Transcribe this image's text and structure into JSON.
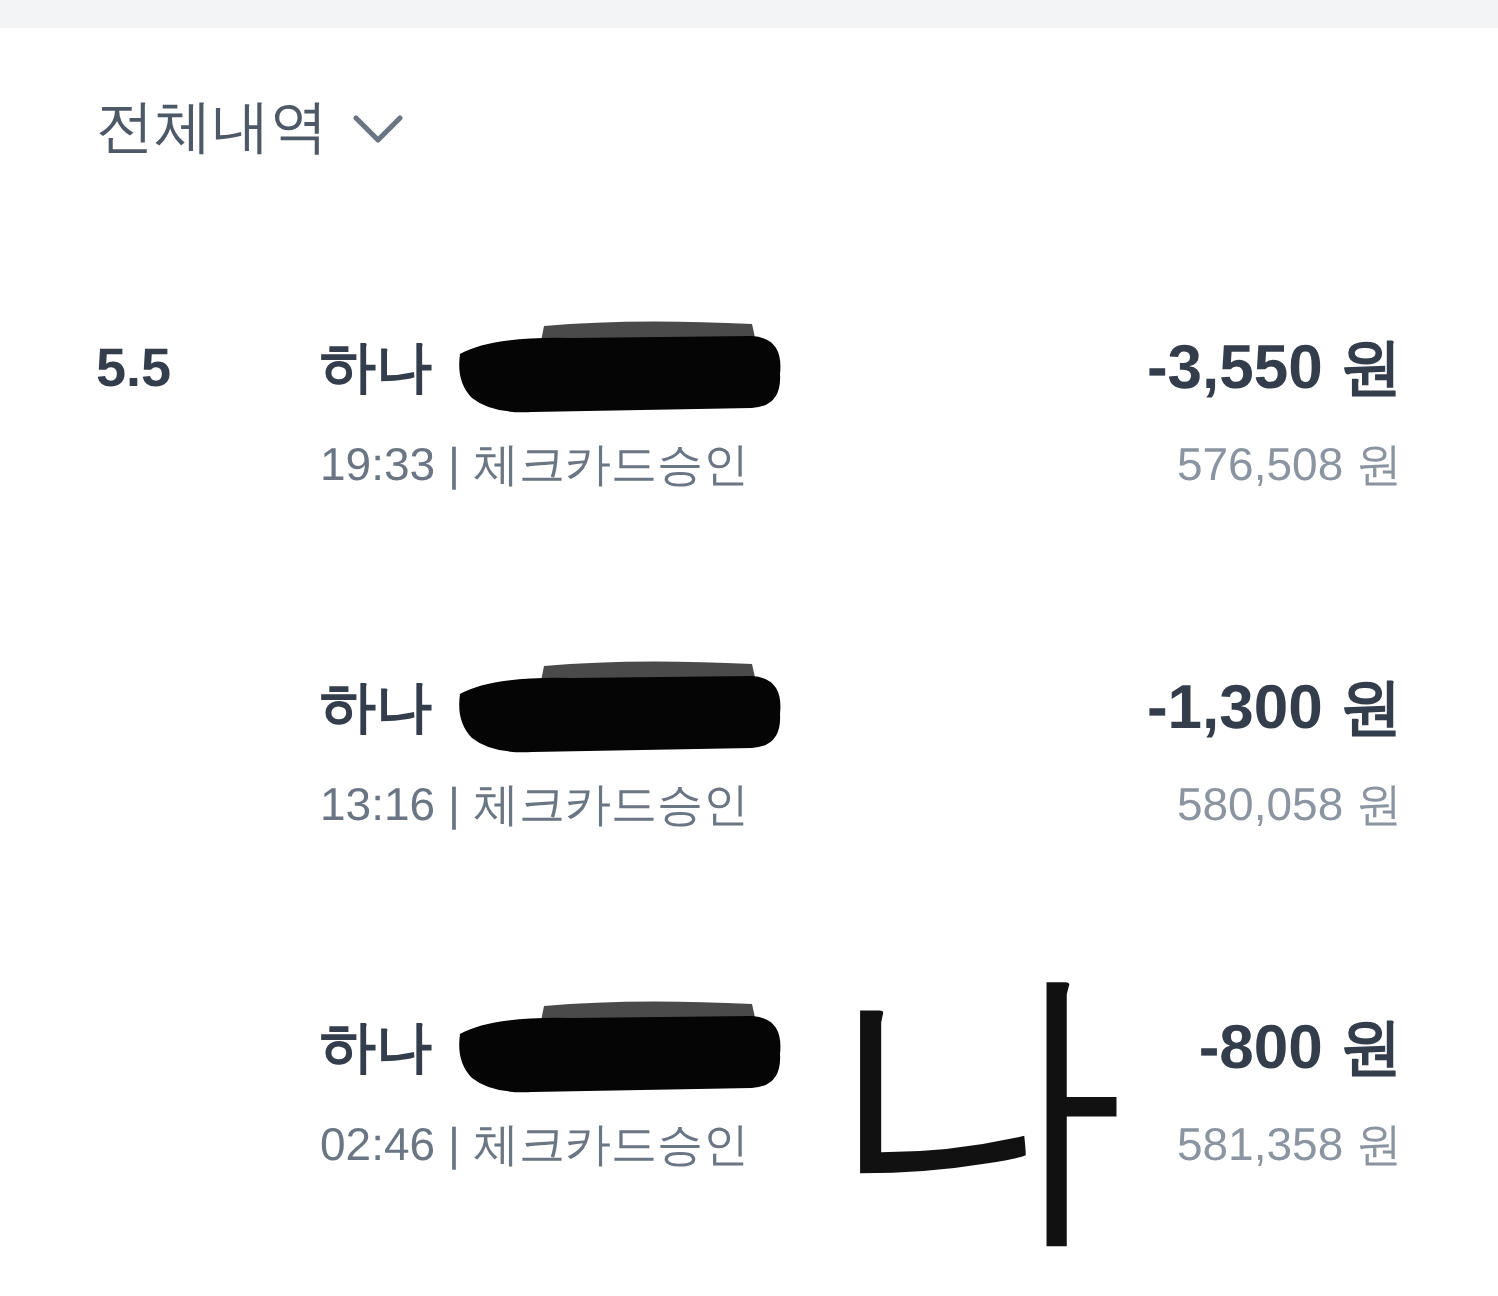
{
  "filter": {
    "label": "전체내역"
  },
  "transactions": [
    {
      "date": "5.5",
      "merchant": "하나",
      "redacted": true,
      "detail": "19:33 | 체크카드승인",
      "amount": "-3,550 원",
      "balance": "576,508 원"
    },
    {
      "merchant": "하나",
      "redacted": true,
      "detail": "13:16 | 체크카드승인",
      "amount": "-1,300 원",
      "balance": "580,058 원"
    },
    {
      "merchant": "하나",
      "redacted": true,
      "detail": "02:46 | 체크카드승인",
      "amount": "-800 원",
      "balance": "581,358 원"
    }
  ],
  "annotation": {
    "text": "나"
  }
}
